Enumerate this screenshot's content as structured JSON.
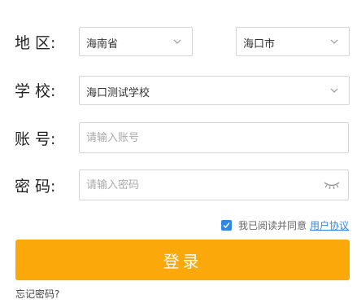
{
  "form": {
    "region_label": "地  区:",
    "province": "海南省",
    "city": "海口市",
    "school_label": "学  校:",
    "school": "海口测试学校",
    "account_label": "账  号:",
    "account_placeholder": "请输入账号",
    "password_label": "密  码:",
    "password_placeholder": "请输入密码",
    "agree_text": "我已阅读并同意",
    "agree_link": "用户协议",
    "agree_checked": true,
    "login_button": "登录",
    "forgot_password": "忘记密码?"
  },
  "colors": {
    "accent": "#fba90a",
    "link": "#2f87e6",
    "border": "#d6d6d6"
  },
  "icons": {
    "select_arrow": "chevron-down-icon",
    "password_visibility": "eye-closed-icon",
    "agree_checkbox": "checkmark-icon"
  }
}
